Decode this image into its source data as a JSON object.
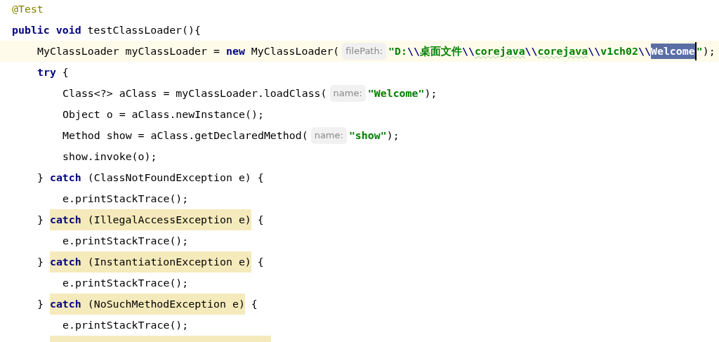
{
  "editor": {
    "lines": [
      {
        "current": false,
        "pieces": [
          {
            "kind": "code",
            "tokens": [
              {
                "text": "@Test",
                "kind": "annotation"
              }
            ]
          }
        ]
      },
      {
        "current": false,
        "pieces": [
          {
            "kind": "code",
            "tokens": [
              {
                "text": "public void",
                "kind": "keyword"
              },
              {
                "text": " testClassLoader(){",
                "kind": "plain"
              }
            ]
          }
        ],
        "children": [
          {
            "current": true,
            "pieces": [
              {
                "kind": "code",
                "tokens": [
                  {
                    "text": "MyClassLoader myClassLoader = ",
                    "kind": "plain"
                  },
                  {
                    "text": "new",
                    "kind": "keyword"
                  },
                  {
                    "text": " MyClassLoader(",
                    "kind": "plain"
                  }
                ]
              },
              {
                "kind": "hint",
                "tokens": [
                  {
                    "text": "filePath:",
                    "kind": "plain"
                  }
                ]
              },
              {
                "kind": "code",
                "tokens": [
                  {
                    "text": "\"D:",
                    "kind": "string"
                  },
                  {
                    "text": "\\\\",
                    "kind": "escape"
                  },
                  {
                    "text": "桌面文件",
                    "kind": "string"
                  },
                  {
                    "text": "\\\\",
                    "kind": "escape"
                  },
                  {
                    "text": "corejava",
                    "kind": "typo_string"
                  },
                  {
                    "text": "\\\\",
                    "kind": "escape"
                  },
                  {
                    "text": "corejava",
                    "kind": "typo_string"
                  },
                  {
                    "text": "\\\\",
                    "kind": "escape"
                  },
                  {
                    "text": "v1ch02",
                    "kind": "string"
                  },
                  {
                    "text": "\\\\",
                    "kind": "escape"
                  }
                ]
              },
              {
                "kind": "selection",
                "tokens": [
                  {
                    "text": "Welcome",
                    "kind": "string"
                  }
                ]
              },
              {
                "kind": "caret"
              },
              {
                "kind": "code",
                "tokens": [
                  {
                    "text": "\"",
                    "kind": "string"
                  },
                  {
                    "text": ");",
                    "kind": "plain"
                  }
                ]
              }
            ]
          },
          {
            "current": false,
            "pieces": [
              {
                "kind": "code",
                "tokens": [
                  {
                    "text": "try",
                    "kind": "keyword"
                  },
                  {
                    "text": " {",
                    "kind": "plain"
                  }
                ]
              }
            ],
            "children": [
              {
                "current": false,
                "pieces": [
                  {
                    "kind": "code",
                    "tokens": [
                      {
                        "text": "Class<?> aClass = myClassLoader.loadClass(",
                        "kind": "plain"
                      }
                    ]
                  },
                  {
                    "kind": "hint",
                    "tokens": [
                      {
                        "text": "name:",
                        "kind": "plain"
                      }
                    ]
                  },
                  {
                    "kind": "code",
                    "tokens": [
                      {
                        "text": "\"Welcome\"",
                        "kind": "string"
                      },
                      {
                        "text": ");",
                        "kind": "plain"
                      }
                    ]
                  }
                ]
              },
              {
                "current": false,
                "pieces": [
                  {
                    "kind": "code",
                    "tokens": [
                      {
                        "text": "Object o = aClass.newInstance();",
                        "kind": "plain"
                      }
                    ]
                  }
                ]
              },
              {
                "current": false,
                "pieces": [
                  {
                    "kind": "code",
                    "tokens": [
                      {
                        "text": "Method show = aClass.getDeclaredMethod(",
                        "kind": "plain"
                      }
                    ]
                  },
                  {
                    "kind": "hint",
                    "tokens": [
                      {
                        "text": "name:",
                        "kind": "plain"
                      }
                    ]
                  },
                  {
                    "kind": "code",
                    "tokens": [
                      {
                        "text": "\"show\"",
                        "kind": "string"
                      },
                      {
                        "text": ");",
                        "kind": "plain"
                      }
                    ]
                  }
                ]
              },
              {
                "current": false,
                "pieces": [
                  {
                    "kind": "code",
                    "tokens": [
                      {
                        "text": "show.invoke(o);",
                        "kind": "plain"
                      }
                    ]
                  }
                ]
              }
            ]
          },
          {
            "current": false,
            "pieces": [
              {
                "kind": "code",
                "tokens": [
                  {
                    "text": "} ",
                    "kind": "plain"
                  },
                  {
                    "text": "catch",
                    "kind": "keyword"
                  },
                  {
                    "text": " (ClassNotFoundException e) {",
                    "kind": "plain"
                  }
                ]
              }
            ],
            "children": [
              {
                "current": false,
                "pieces": [
                  {
                    "kind": "code",
                    "tokens": [
                      {
                        "text": "e.printStackTrace();",
                        "kind": "plain"
                      }
                    ]
                  }
                ]
              }
            ]
          },
          {
            "current": false,
            "pieces": [
              {
                "kind": "code",
                "tokens": [
                  {
                    "text": "} ",
                    "kind": "plain"
                  }
                ]
              },
              {
                "kind": "highlight",
                "tokens": [
                  {
                    "text": "catch",
                    "kind": "keyword"
                  },
                  {
                    "text": " (IllegalAccessException e)",
                    "kind": "plain"
                  }
                ]
              },
              {
                "kind": "code",
                "tokens": [
                  {
                    "text": " {",
                    "kind": "plain"
                  }
                ]
              }
            ],
            "children": [
              {
                "current": false,
                "pieces": [
                  {
                    "kind": "code",
                    "tokens": [
                      {
                        "text": "e.printStackTrace();",
                        "kind": "plain"
                      }
                    ]
                  }
                ]
              }
            ]
          },
          {
            "current": false,
            "pieces": [
              {
                "kind": "code",
                "tokens": [
                  {
                    "text": "} ",
                    "kind": "plain"
                  }
                ]
              },
              {
                "kind": "highlight",
                "tokens": [
                  {
                    "text": "catch",
                    "kind": "keyword"
                  },
                  {
                    "text": " (InstantiationException e)",
                    "kind": "plain"
                  }
                ]
              },
              {
                "kind": "code",
                "tokens": [
                  {
                    "text": " {",
                    "kind": "plain"
                  }
                ]
              }
            ],
            "children": [
              {
                "current": false,
                "pieces": [
                  {
                    "kind": "code",
                    "tokens": [
                      {
                        "text": "e.printStackTrace();",
                        "kind": "plain"
                      }
                    ]
                  }
                ]
              }
            ]
          },
          {
            "current": false,
            "pieces": [
              {
                "kind": "code",
                "tokens": [
                  {
                    "text": "} ",
                    "kind": "plain"
                  }
                ]
              },
              {
                "kind": "highlight",
                "tokens": [
                  {
                    "text": "catch",
                    "kind": "keyword"
                  },
                  {
                    "text": " (NoSuchMethodException e)",
                    "kind": "plain"
                  }
                ]
              },
              {
                "kind": "code",
                "tokens": [
                  {
                    "text": " {",
                    "kind": "plain"
                  }
                ]
              }
            ],
            "children": [
              {
                "current": false,
                "pieces": [
                  {
                    "kind": "code",
                    "tokens": [
                      {
                        "text": "e.printStackTrace();",
                        "kind": "plain"
                      }
                    ]
                  }
                ]
              }
            ]
          },
          {
            "current": false,
            "pieces": [
              {
                "kind": "clipped_highlight"
              }
            ]
          }
        ]
      }
    ]
  }
}
